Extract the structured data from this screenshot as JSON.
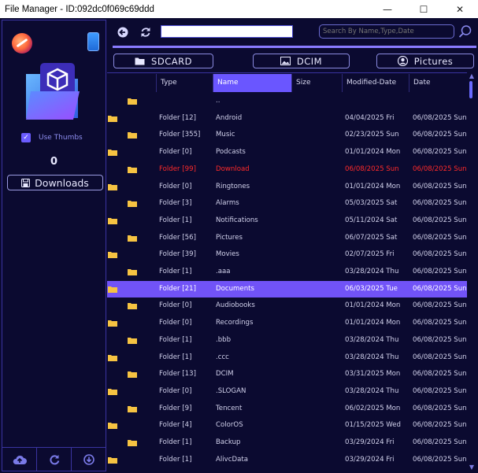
{
  "window": {
    "title": "File Manager - ID:092dc0f069c69ddd",
    "minimize": "—",
    "maximize": "☐",
    "close": "✕"
  },
  "sidebar": {
    "use_thumbs_label": "Use Thumbs",
    "use_thumbs_checked": true,
    "count": "0",
    "downloads_label": "Downloads"
  },
  "toolbar": {
    "path_value": "",
    "search_placeholder": "Search By Name,Type,Date"
  },
  "quick_access": [
    {
      "label": "SDCARD",
      "icon": "folder-icon"
    },
    {
      "label": "DCIM",
      "icon": "image-icon"
    },
    {
      "label": "Pictures",
      "icon": "user-icon"
    }
  ],
  "table": {
    "columns": [
      "",
      "Type",
      "Name",
      "Size",
      "Modified-Date",
      "Date"
    ],
    "sorted_column": "Name",
    "rows": [
      {
        "type": "",
        "name": "..",
        "size": "",
        "modified": "",
        "date": ""
      },
      {
        "type": "Folder [12]",
        "name": "Android",
        "size": "",
        "modified": "04/04/2025 Fri",
        "date": "06/08/2025 Sun"
      },
      {
        "type": "Folder [355]",
        "name": "Music",
        "size": "",
        "modified": "02/23/2025 Sun",
        "date": "06/08/2025 Sun"
      },
      {
        "type": "Folder [0]",
        "name": "Podcasts",
        "size": "",
        "modified": "01/01/2024 Mon",
        "date": "06/08/2025 Sun"
      },
      {
        "type": "Folder [99]",
        "name": "Download",
        "size": "",
        "modified": "06/08/2025 Sun",
        "date": "06/08/2025 Sun",
        "highlight": true
      },
      {
        "type": "Folder [0]",
        "name": "Ringtones",
        "size": "",
        "modified": "01/01/2024 Mon",
        "date": "06/08/2025 Sun"
      },
      {
        "type": "Folder [3]",
        "name": "Alarms",
        "size": "",
        "modified": "05/03/2025 Sat",
        "date": "06/08/2025 Sun"
      },
      {
        "type": "Folder [1]",
        "name": "Notifications",
        "size": "",
        "modified": "05/11/2024 Sat",
        "date": "06/08/2025 Sun"
      },
      {
        "type": "Folder [56]",
        "name": "Pictures",
        "size": "",
        "modified": "06/07/2025 Sat",
        "date": "06/08/2025 Sun"
      },
      {
        "type": "Folder [39]",
        "name": "Movies",
        "size": "",
        "modified": "02/07/2025 Fri",
        "date": "06/08/2025 Sun"
      },
      {
        "type": "Folder [1]",
        "name": ".aaa",
        "size": "",
        "modified": "03/28/2024 Thu",
        "date": "06/08/2025 Sun"
      },
      {
        "type": "Folder [21]",
        "name": "Documents",
        "size": "",
        "modified": "06/03/2025 Tue",
        "date": "06/08/2025 Sun",
        "selected": true
      },
      {
        "type": "Folder [0]",
        "name": "Audiobooks",
        "size": "",
        "modified": "01/01/2024 Mon",
        "date": "06/08/2025 Sun"
      },
      {
        "type": "Folder [0]",
        "name": "Recordings",
        "size": "",
        "modified": "01/01/2024 Mon",
        "date": "06/08/2025 Sun"
      },
      {
        "type": "Folder [1]",
        "name": ".bbb",
        "size": "",
        "modified": "03/28/2024 Thu",
        "date": "06/08/2025 Sun"
      },
      {
        "type": "Folder [1]",
        "name": ".ccc",
        "size": "",
        "modified": "03/28/2024 Thu",
        "date": "06/08/2025 Sun"
      },
      {
        "type": "Folder [13]",
        "name": "DCIM",
        "size": "",
        "modified": "03/31/2025 Mon",
        "date": "06/08/2025 Sun"
      },
      {
        "type": "Folder [0]",
        "name": ".SLOGAN",
        "size": "",
        "modified": "03/28/2024 Thu",
        "date": "06/08/2025 Sun"
      },
      {
        "type": "Folder [9]",
        "name": "Tencent",
        "size": "",
        "modified": "06/02/2025 Mon",
        "date": "06/08/2025 Sun"
      },
      {
        "type": "Folder [4]",
        "name": "ColorOS",
        "size": "",
        "modified": "01/15/2025 Wed",
        "date": "06/08/2025 Sun"
      },
      {
        "type": "Folder [1]",
        "name": "Backup",
        "size": "",
        "modified": "03/29/2024 Fri",
        "date": "06/08/2025 Sun"
      },
      {
        "type": "Folder [1]",
        "name": "AlivcData",
        "size": "",
        "modified": "03/29/2024 Fri",
        "date": "06/08/2025 Sun"
      }
    ]
  },
  "colors": {
    "background": "#0b0a30",
    "accent": "#7153f7",
    "highlight_text": "#ff2a2a",
    "folder": "#f6c342"
  }
}
